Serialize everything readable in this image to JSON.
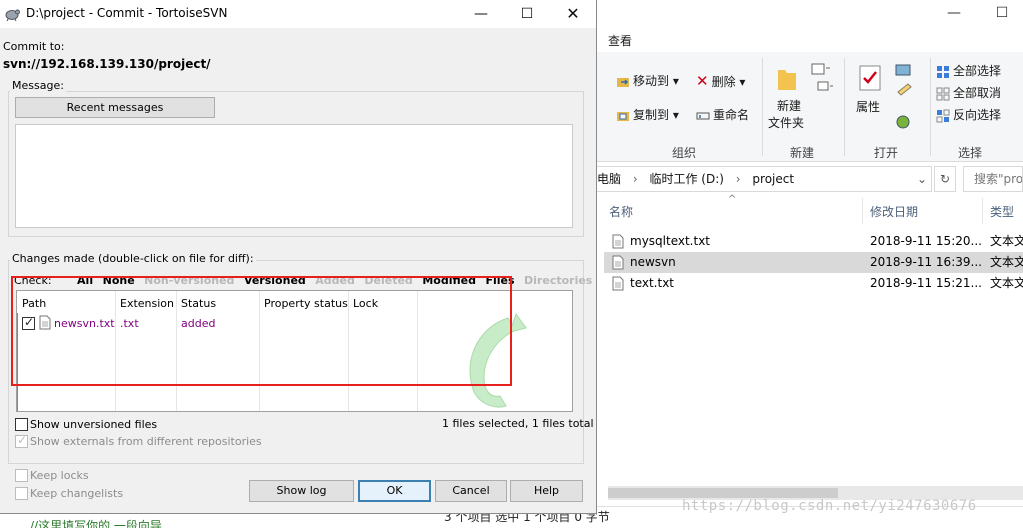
{
  "dialog": {
    "title": "D:\\project - Commit - TortoiseSVN",
    "commit_to_label": "Commit to:",
    "commit_to_url": "svn://192.168.139.130/project/",
    "message_label": "Message:",
    "recent_messages_button": "Recent messages",
    "message_text": "",
    "changes_label": "Changes made (double-click on file for diff):",
    "check_label": "Check:",
    "check_links": [
      {
        "label": "All",
        "enabled": true
      },
      {
        "label": "None",
        "enabled": true
      },
      {
        "label": "Non-versioned",
        "enabled": false
      },
      {
        "label": "Versioned",
        "enabled": true
      },
      {
        "label": "Added",
        "enabled": false
      },
      {
        "label": "Deleted",
        "enabled": false
      },
      {
        "label": "Modified",
        "enabled": true
      },
      {
        "label": "Files",
        "enabled": true
      },
      {
        "label": "Directories",
        "enabled": false
      }
    ],
    "columns": [
      "Path",
      "Extension",
      "Status",
      "Property status",
      "Lock"
    ],
    "rows": [
      {
        "checked": true,
        "path": "newsvn.txt",
        "extension": ".txt",
        "status": "added",
        "property_status": "",
        "lock": ""
      }
    ],
    "show_unversioned": "Show unversioned files",
    "show_externals": "Show externals from different repositories",
    "files_selected": "1 files selected, 1 files total",
    "keep_locks": "Keep locks",
    "keep_changelists": "Keep changelists",
    "buttons": {
      "show_log": "Show log",
      "ok": "OK",
      "cancel": "Cancel",
      "help": "Help"
    },
    "highlight_color": "#e8201c"
  },
  "explorer": {
    "tab_view": "查看",
    "ribbon": {
      "move_to": "移动到",
      "copy_to": "复制到",
      "delete": "删除",
      "rename": "重命名",
      "new_folder_line1": "新建",
      "new_folder_line2": "文件夹",
      "properties": "属性",
      "select_all": "全部选择",
      "select_none": "全部取消",
      "invert_selection": "反向选择",
      "group_organize": "组织",
      "group_new": "新建",
      "group_open": "打开",
      "group_select": "选择"
    },
    "address": {
      "part1": "电脑",
      "part2": "临时工作 (D:)",
      "part3": "project"
    },
    "search_placeholder": "搜索\"pro",
    "columns": {
      "name": "名称",
      "modified": "修改日期",
      "type": "类型"
    },
    "files": [
      {
        "name": "mysqltext.txt",
        "modified": "2018-9-11 15:20...",
        "type": "文本文",
        "selected": false
      },
      {
        "name": "newsvn",
        "modified": "2018-9-11 16:39...",
        "type": "文本文",
        "selected": true
      },
      {
        "name": "text.txt",
        "modified": "2018-9-11 15:21...",
        "type": "文本文",
        "selected": false
      }
    ],
    "status_text": "3 个项目    选中 1 个项目 0 字节"
  },
  "watermark": "https://blog.csdn.net/yi247630676",
  "bottom_text": "//这里填写你的 一段向导"
}
